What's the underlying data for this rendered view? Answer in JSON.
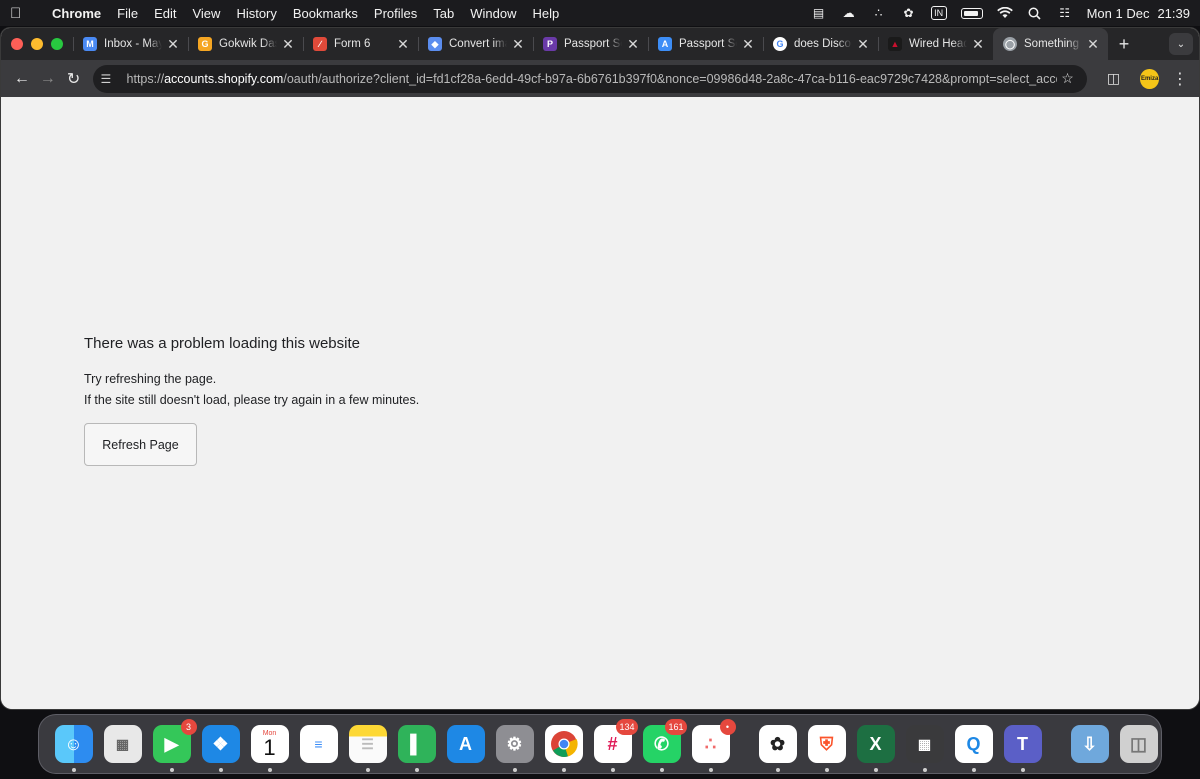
{
  "menubar": {
    "apple": "",
    "app_name": "Chrome",
    "menus": [
      "File",
      "Edit",
      "View",
      "History",
      "Bookmarks",
      "Profiles",
      "Tab",
      "Window",
      "Help"
    ],
    "input_source": "IN",
    "date": "Mon 1 Dec",
    "time": "21:39"
  },
  "tabs": [
    {
      "title": "Inbox - Maya",
      "favicon": "gmail-icon",
      "color": "#4a8af4"
    },
    {
      "title": "Gokwik Dash",
      "favicon": "gokwik-icon",
      "color": "#f5a623"
    },
    {
      "title": "Form 6",
      "favicon": "form-icon",
      "color": "#e04a3a"
    },
    {
      "title": "Convert imag",
      "favicon": "convert-icon",
      "color": "#5b8def"
    },
    {
      "title": "Passport Sev",
      "favicon": "passport-icon",
      "color": "#6a3aa8"
    },
    {
      "title": "Passport Sev",
      "favicon": "appstore-icon",
      "color": "#3d8ef7"
    },
    {
      "title": "does Discour",
      "favicon": "google-icon",
      "color": "#ffffff"
    },
    {
      "title": "Wired Headp",
      "favicon": "headphones-icon",
      "color": "#c8102e"
    },
    {
      "title": "Something w",
      "favicon": "globe-icon",
      "color": "#9aa0a6",
      "active": true
    }
  ],
  "toolbar": {
    "url_scheme": "https://",
    "url_host": "accounts.shopify.com",
    "url_rest": "/oauth/authorize?client_id=fd1cf28a-6edd-49cf-b97a-6b6761b397f0&nonce=09986d48-2a8c-47ca-b116-eac9729c7428&prompt=select_accou...",
    "profile_label": "Emiza"
  },
  "error_page": {
    "title": "There was a problem loading this website",
    "line1": "Try refreshing the page.",
    "line2": "If the site still doesn't load, please try again in a few minutes.",
    "button": "Refresh Page"
  },
  "dock": [
    {
      "name": "finder",
      "color": "#2d8cf0",
      "running": true
    },
    {
      "name": "launchpad",
      "color": "#e8e8e8",
      "running": false
    },
    {
      "name": "facetime",
      "color": "#34c759",
      "badge": "3",
      "running": true
    },
    {
      "name": "safari",
      "color": "#1e88e5",
      "running": true
    },
    {
      "name": "calendar",
      "color": "#ffffff",
      "cal_day": "Mon",
      "cal_date": "1",
      "running": true
    },
    {
      "name": "reminders",
      "color": "#ffffff",
      "running": false
    },
    {
      "name": "notes",
      "color": "#fdd835",
      "running": true
    },
    {
      "name": "numbers",
      "color": "#2fb35a",
      "running": true
    },
    {
      "name": "app-store",
      "color": "#1e88e5",
      "running": false
    },
    {
      "name": "system-settings",
      "color": "#8e8e93",
      "running": true
    },
    {
      "name": "chrome",
      "color": "#ffffff",
      "running": true
    },
    {
      "name": "slack",
      "color": "#ffffff",
      "badge": "134",
      "running": true
    },
    {
      "name": "whatsapp",
      "color": "#25d366",
      "badge": "161",
      "running": true
    },
    {
      "name": "asana",
      "color": "#ffffff",
      "badge": "•",
      "running": true
    },
    {
      "name": "chatgpt",
      "color": "#ffffff",
      "running": true
    },
    {
      "name": "brave",
      "color": "#fb542b",
      "running": true
    },
    {
      "name": "excel",
      "color": "#1d6f42",
      "running": true
    },
    {
      "name": "calculator",
      "color": "#3a3a3c",
      "running": true
    },
    {
      "name": "quickq",
      "color": "#1e88e5",
      "running": true
    },
    {
      "name": "teams",
      "color": "#5b5fc7",
      "running": true
    },
    {
      "name": "downloads",
      "color": "#6fa8dc",
      "running": false
    },
    {
      "name": "trash",
      "color": "#d0d0d0",
      "running": false
    }
  ]
}
